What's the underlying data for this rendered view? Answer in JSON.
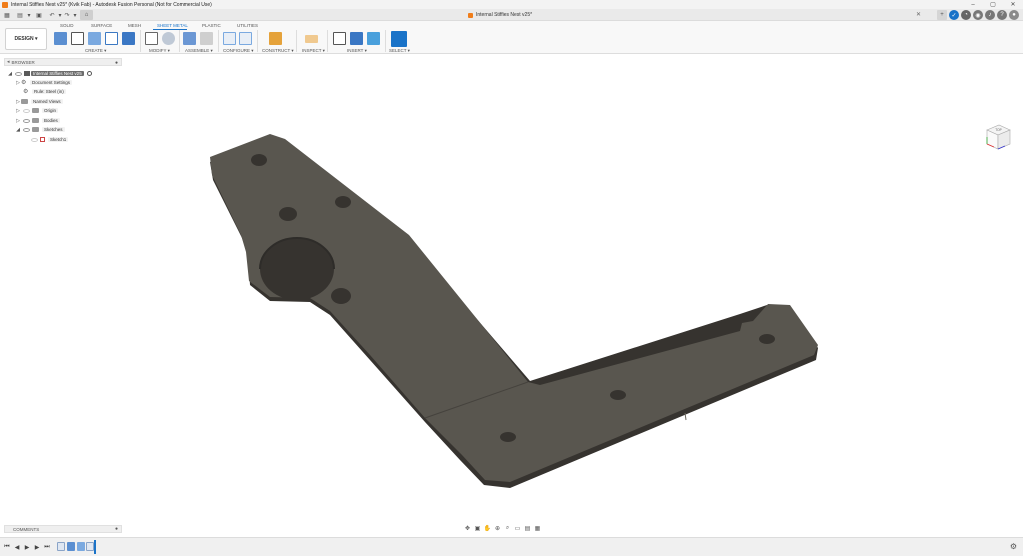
{
  "window": {
    "title": "Internal Stiffies Nest v25* (Kvik Fab) - Autodesk Fusion Personal (Not for Commercial Use)",
    "controls": [
      "–",
      "▢",
      "✕"
    ]
  },
  "document_tab": {
    "label": "Internal Stiffies Nest v25*"
  },
  "ribbon": {
    "workspace_button": "DESIGN ▾",
    "tabs": [
      "SOLID",
      "SURFACE",
      "MESH",
      "SHEET METAL",
      "PLASTIC",
      "UTILITIES"
    ],
    "active_tab": "SHEET METAL",
    "groups": [
      "CREATE ▾",
      "MODIFY ▾",
      "ASSEMBLE ▾",
      "CONFIGURE ▾",
      "CONSTRUCT ▾",
      "INSPECT ▾",
      "INSERT ▾",
      "SELECT ▾"
    ]
  },
  "browser": {
    "header": "BROWSER",
    "items": [
      {
        "label": "Internal Stiffies Nest v25"
      },
      {
        "label": "Document Settings"
      },
      {
        "label": "Rule: Steel (in)"
      },
      {
        "label": "Named Views"
      },
      {
        "label": "Origin"
      },
      {
        "label": "Bodies"
      },
      {
        "label": "Sketches"
      },
      {
        "label": "Sketch1"
      }
    ]
  },
  "comments": {
    "label": "COMMENTS"
  },
  "viewcube": {
    "face_label": "TOP"
  },
  "colors": {
    "part_top": "#5a5750",
    "part_edge": "#3a3834",
    "accent": "#1a73c8",
    "brand_orange": "#f07d1a"
  }
}
